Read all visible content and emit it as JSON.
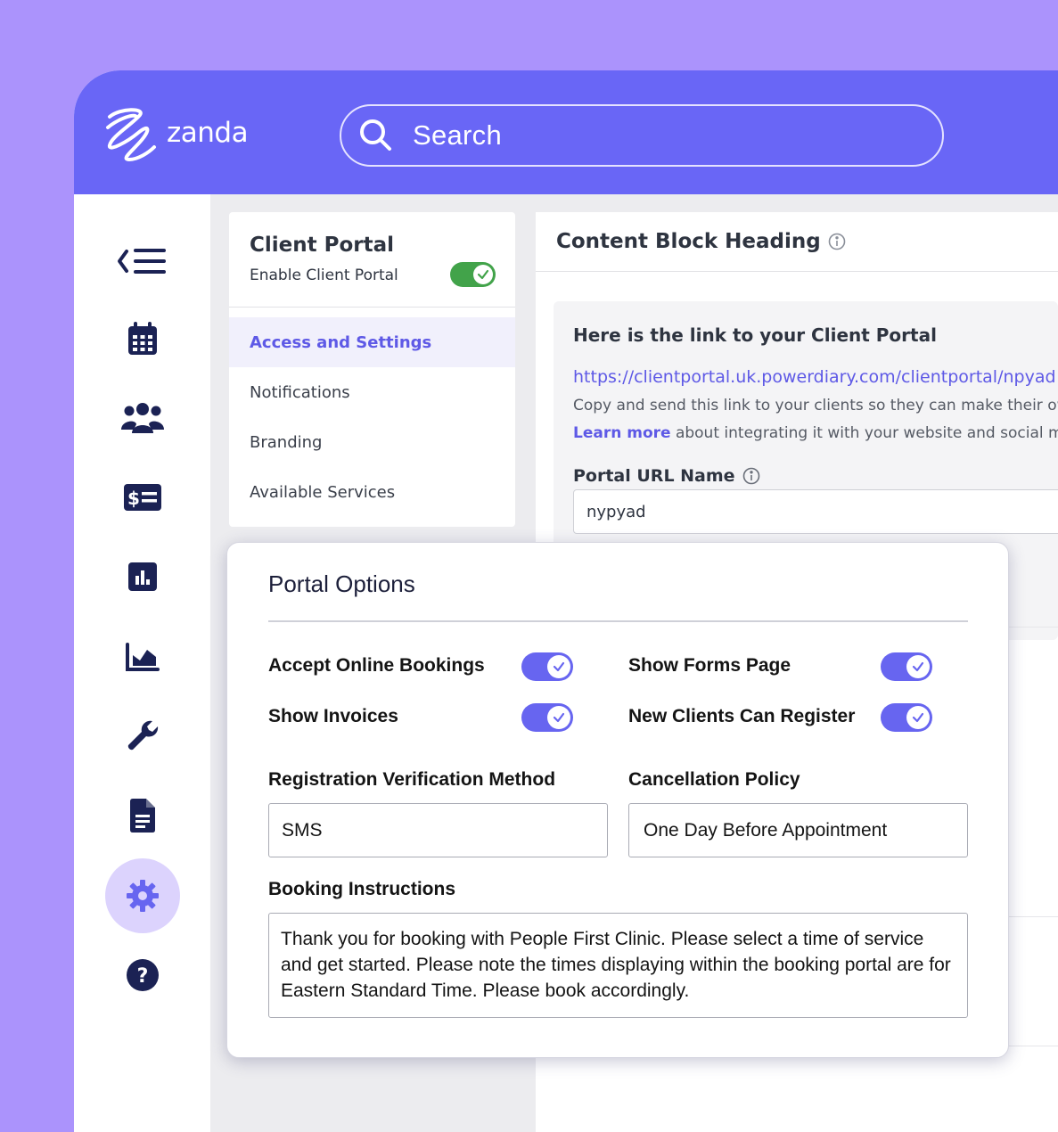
{
  "brand": {
    "name": "zanda"
  },
  "search": {
    "placeholder": "Search"
  },
  "sidebar": {
    "items": [
      {
        "icon": "collapse-menu-icon"
      },
      {
        "icon": "calendar-icon"
      },
      {
        "icon": "people-icon"
      },
      {
        "icon": "billing-icon"
      },
      {
        "icon": "bar-chart-icon"
      },
      {
        "icon": "area-chart-icon"
      },
      {
        "icon": "wrench-icon"
      },
      {
        "icon": "document-icon"
      },
      {
        "icon": "gear-icon",
        "active": true
      },
      {
        "icon": "help-icon"
      }
    ]
  },
  "client_portal": {
    "title": "Client Portal",
    "enable_label": "Enable Client Portal",
    "enabled": true,
    "menu": [
      {
        "label": "Access and Settings",
        "active": true
      },
      {
        "label": "Notifications"
      },
      {
        "label": "Branding"
      },
      {
        "label": "Available Services"
      }
    ]
  },
  "content_block": {
    "heading": "Content Block Heading",
    "link_title": "Here is the link to your Client Portal",
    "link_url": "https://clientportal.uk.powerdiary.com/clientportal/npyad",
    "copy_text": "Copy and send this link to your clients so they can make their own",
    "learn_more": "Learn more",
    "learn_more_rest": " about integrating it with your website and social media",
    "url_name_label": "Portal URL Name",
    "url_name_value": "nypyad"
  },
  "portal_options": {
    "title": "Portal Options",
    "toggles": [
      {
        "label": "Accept Online Bookings",
        "on": true
      },
      {
        "label": "Show Forms Page",
        "on": true
      },
      {
        "label": "Show Invoices",
        "on": true
      },
      {
        "label": "New Clients Can Register",
        "on": true
      }
    ],
    "verification": {
      "label": "Registration Verification Method",
      "value": "SMS"
    },
    "cancellation": {
      "label": "Cancellation Policy",
      "value": "One Day Before Appointment"
    },
    "instructions": {
      "label": "Booking Instructions",
      "value": "Thank you for booking with People First Clinic. Please select a time of service and get started. Please note the times displaying within the booking portal are for Eastern Standard Time. Please book accordingly."
    }
  },
  "colors": {
    "background": "#ab93fc",
    "topbar": "#6966f6",
    "accent": "#5e59e6",
    "toggle_on": "#6765f0",
    "toggle_green": "#42a34a",
    "nav_active": "#dcd3fd",
    "icon_dark": "#1b2254"
  }
}
